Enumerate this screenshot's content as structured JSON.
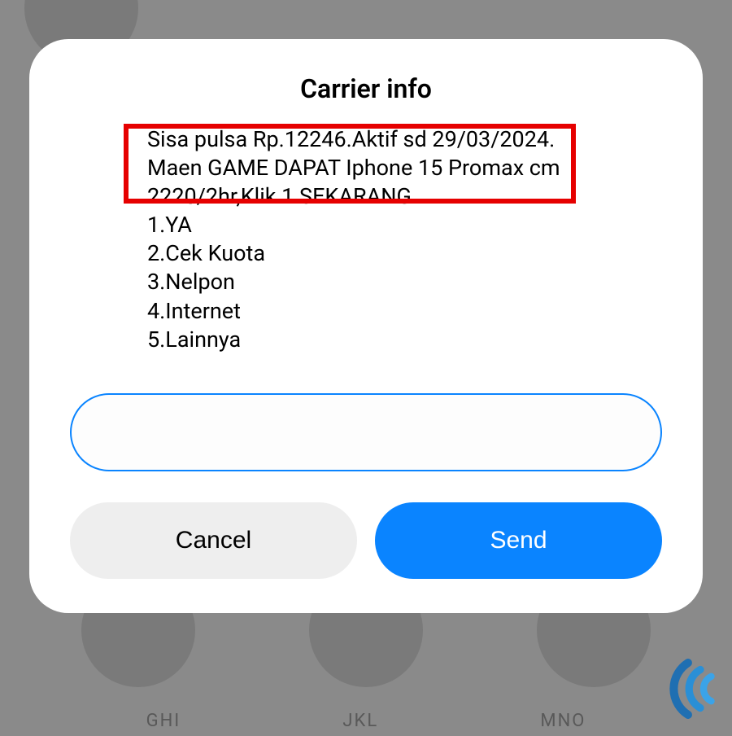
{
  "dialog": {
    "title": "Carrier info",
    "message": "Sisa pulsa Rp.12246.Aktif sd 29/03/2024.\nMaen GAME DAPAT Iphone 15 Promax cm 2220/2hr,Klik 1 SEKARANG\n1.YA\n2.Cek Kuota\n3.Nelpon\n4.Internet\n5.Lainnya",
    "input_value": "",
    "cancel_label": "Cancel",
    "send_label": "Send"
  },
  "keyboard": {
    "key1": "GHI",
    "key2": "JKL",
    "key3": "MNO"
  },
  "highlight": {
    "color": "#e60000"
  }
}
